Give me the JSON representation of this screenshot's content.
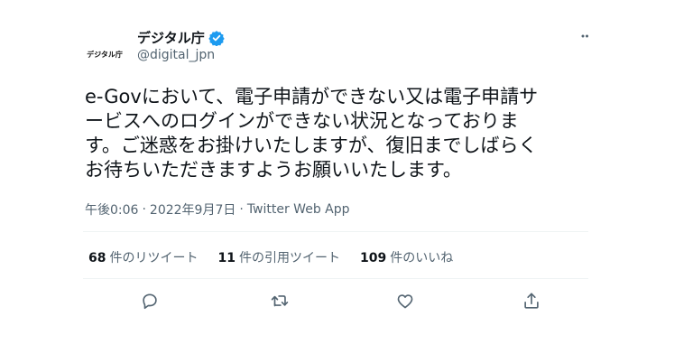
{
  "author": {
    "display_name": "デジタル庁",
    "handle": "@digital_jpn",
    "avatar_text": "デジタル庁",
    "verified": true
  },
  "tweet": {
    "lines": [
      "e-Govにおいて、電子申請ができない又は電子申請サ",
      "ービスへのログインができない状況となっておりま",
      "す。ご迷惑をお掛けいたしますが、復旧までしばらく",
      "お待ちいただきますようお願いいたします。"
    ],
    "time": "午後0:06",
    "date": "2022年9月7日",
    "separator": "·",
    "source": "Twitter Web App"
  },
  "stats": {
    "retweets": {
      "count": "68",
      "label": "件のリツイート"
    },
    "quotes": {
      "count": "11",
      "label": "件の引用ツイート"
    },
    "likes": {
      "count": "109",
      "label": "件のいいね"
    }
  },
  "icons": {
    "verified": "verified-badge-icon",
    "more": "more-dots-icon",
    "reply": "reply-icon",
    "retweet": "retweet-icon",
    "like": "like-icon",
    "share": "share-icon"
  },
  "colors": {
    "text": "#0f1419",
    "secondary": "#536471",
    "verified": "#1d9bf0",
    "divider": "#eff3f4"
  }
}
